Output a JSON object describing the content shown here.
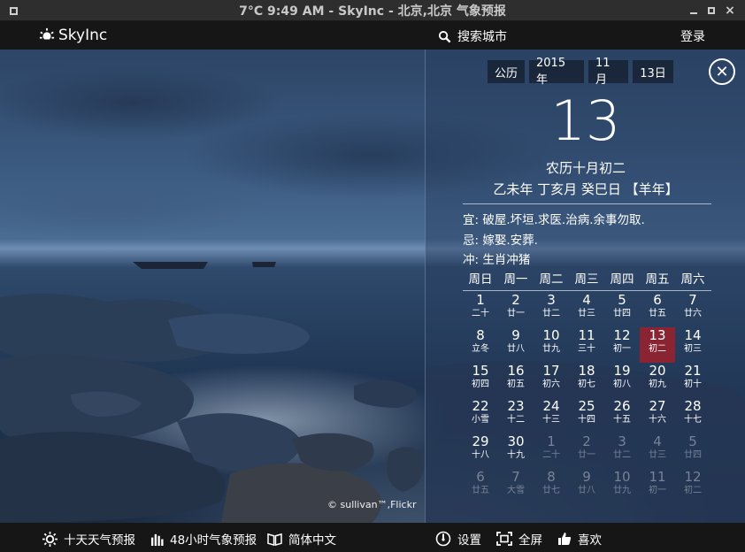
{
  "window": {
    "title": "7°C 9:49 AM - SkyInc - 北京,北京 气象预报"
  },
  "header": {
    "logo_text": "SkyInc",
    "search_label": "搜索城市",
    "login_label": "登录"
  },
  "photo": {
    "credit": "© sullivan™,Flickr"
  },
  "calendar": {
    "calendar_type": "公历",
    "year": "2015年",
    "month": "11月",
    "day": "13日",
    "big_day": "13",
    "lunar_date": "农历十月初二",
    "ganzhi": "乙未年 丁亥月 癸巳日 【羊年】",
    "yi": "宜: 破屋.坏垣.求医.治病.余事勿取.",
    "ji": "忌: 嫁娶.安葬.",
    "chong": "冲: 生肖冲猪",
    "weekdays": [
      "周日",
      "周一",
      "周二",
      "周三",
      "周四",
      "周五",
      "周六"
    ],
    "days": [
      {
        "d": "1",
        "l": "二十"
      },
      {
        "d": "2",
        "l": "廿一"
      },
      {
        "d": "3",
        "l": "廿二"
      },
      {
        "d": "4",
        "l": "廿三"
      },
      {
        "d": "5",
        "l": "廿四"
      },
      {
        "d": "6",
        "l": "廿五"
      },
      {
        "d": "7",
        "l": "廿六"
      },
      {
        "d": "8",
        "l": "立冬"
      },
      {
        "d": "9",
        "l": "廿八"
      },
      {
        "d": "10",
        "l": "廿九"
      },
      {
        "d": "11",
        "l": "三十"
      },
      {
        "d": "12",
        "l": "初一"
      },
      {
        "d": "13",
        "l": "初二"
      },
      {
        "d": "14",
        "l": "初三"
      },
      {
        "d": "15",
        "l": "初四"
      },
      {
        "d": "16",
        "l": "初五"
      },
      {
        "d": "17",
        "l": "初六"
      },
      {
        "d": "18",
        "l": "初七"
      },
      {
        "d": "19",
        "l": "初八"
      },
      {
        "d": "20",
        "l": "初九"
      },
      {
        "d": "21",
        "l": "初十"
      },
      {
        "d": "22",
        "l": "小雪"
      },
      {
        "d": "23",
        "l": "十二"
      },
      {
        "d": "24",
        "l": "十三"
      },
      {
        "d": "25",
        "l": "十四"
      },
      {
        "d": "26",
        "l": "十五"
      },
      {
        "d": "27",
        "l": "十六"
      },
      {
        "d": "28",
        "l": "十七"
      },
      {
        "d": "29",
        "l": "十八"
      },
      {
        "d": "30",
        "l": "十九"
      },
      {
        "d": "1",
        "l": "二十",
        "other": true
      },
      {
        "d": "2",
        "l": "廿一",
        "other": true
      },
      {
        "d": "3",
        "l": "廿二",
        "other": true
      },
      {
        "d": "4",
        "l": "廿三",
        "other": true
      },
      {
        "d": "5",
        "l": "廿四",
        "other": true
      },
      {
        "d": "6",
        "l": "廿五",
        "other": true
      },
      {
        "d": "7",
        "l": "大雪",
        "other": true
      },
      {
        "d": "8",
        "l": "廿七",
        "other": true
      },
      {
        "d": "9",
        "l": "廿八",
        "other": true
      },
      {
        "d": "10",
        "l": "廿九",
        "other": true
      },
      {
        "d": "11",
        "l": "初一",
        "other": true
      },
      {
        "d": "12",
        "l": "初二",
        "other": true
      }
    ],
    "today_index": 12,
    "today_color": "#8a2332"
  },
  "footer": {
    "forecast_10day": "十天天气预报",
    "forecast_48h": "48小时气象预报",
    "language": "简体中文",
    "settings": "设置",
    "fullscreen": "全屏",
    "like": "喜欢"
  }
}
